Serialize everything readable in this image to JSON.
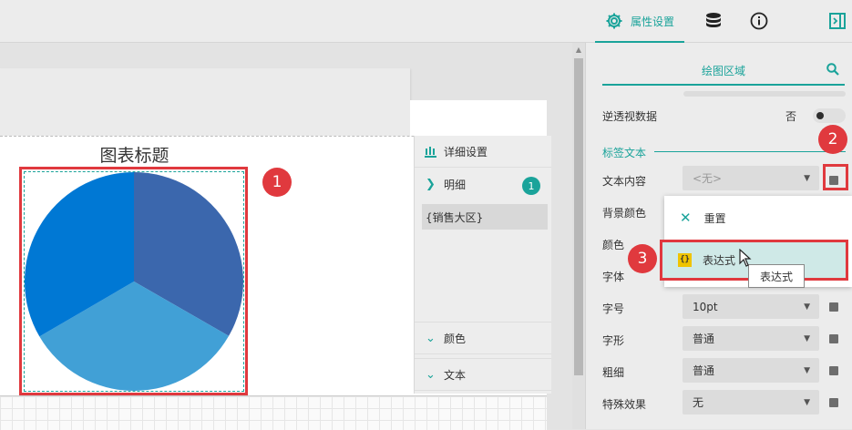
{
  "toolbar": {
    "tabs": [
      {
        "label": "属性设置",
        "icon": "gear-icon",
        "active": true
      },
      {
        "label": "",
        "icon": "database-icon"
      },
      {
        "label": "",
        "icon": "info-icon"
      }
    ],
    "collapse_icon": "panel-collapse-icon"
  },
  "chart": {
    "title": "图表标题",
    "colors": [
      "#3b67ad",
      "#0078d4",
      "#41a0d6"
    ],
    "slices": [
      {
        "fraction": 0.333,
        "color": "#3b67ad"
      },
      {
        "fraction": 0.333,
        "color": "#41a0d6"
      },
      {
        "fraction": 0.334,
        "color": "#0078d4"
      }
    ]
  },
  "detail_panel": {
    "title": "详细设置",
    "detail_label": "明细",
    "detail_count": "1",
    "field": "{销售大区}",
    "color_label": "颜色",
    "text_label": "文本"
  },
  "properties": {
    "plot_area": "绘图区域",
    "reverse_pivot": {
      "label": "逆透视数据",
      "value": "否",
      "enabled": false
    },
    "section": "标签文本",
    "rows": [
      {
        "label": "文本内容",
        "value": "<无>"
      },
      {
        "label": "背景颜色",
        "value": ""
      },
      {
        "label": "颜色",
        "value": ""
      },
      {
        "label": "字体",
        "value": ""
      },
      {
        "label": "字号",
        "value": "10pt"
      },
      {
        "label": "字形",
        "value": "普通"
      },
      {
        "label": "粗细",
        "value": "普通"
      },
      {
        "label": "特殊效果",
        "value": "无"
      }
    ]
  },
  "popup_menu": {
    "reset_label": "重置",
    "expression_label": "表达式",
    "tooltip": "表达式"
  },
  "callouts": [
    "1",
    "2",
    "3"
  ],
  "accent_color": "#1aa39a",
  "callout_color": "#e0393e"
}
